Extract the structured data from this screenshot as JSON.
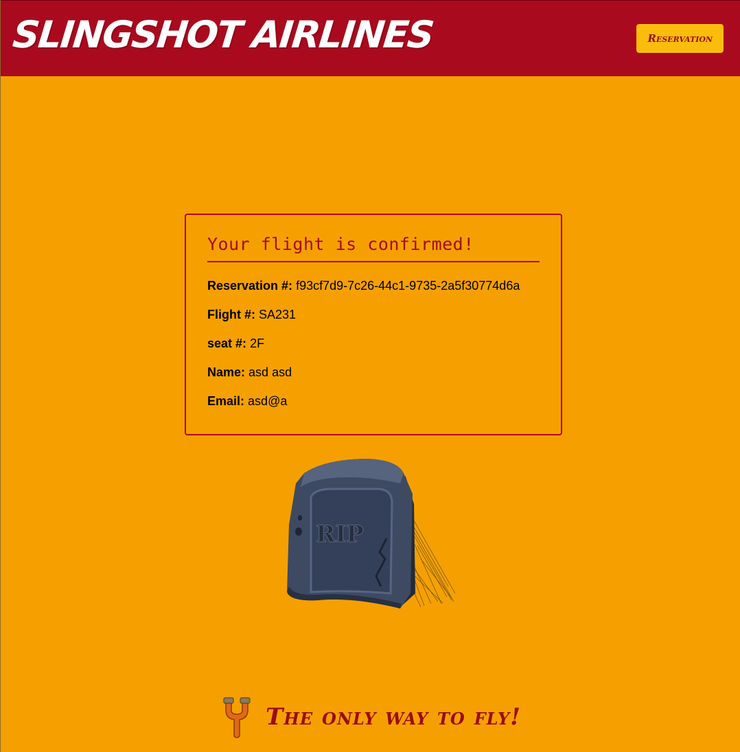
{
  "header": {
    "brand": "Slingshot Airlines",
    "reservation_button": "Reservation",
    "background_color": "#aa0a1e",
    "button_color": "#fbbd0c"
  },
  "confirmation": {
    "title": "Your flight is confirmed!",
    "fields": [
      {
        "label": "Reservation #:",
        "value": "f93cf7d9-7c26-44c1-9735-2a5f30774d6a"
      },
      {
        "label": "Flight #:",
        "value": "SA231"
      },
      {
        "label": "seat #:",
        "value": "2F"
      },
      {
        "label": "Name:",
        "value": "asd asd"
      },
      {
        "label": "Email:",
        "value": "asd@a"
      }
    ],
    "border_color": "#b3081c"
  },
  "illustration": {
    "icon": "tombstone-icon",
    "engraving": "RIP"
  },
  "footer": {
    "icon": "slingshot-icon",
    "tagline": "The only way to fly!"
  },
  "page": {
    "background_color": "#f5a000"
  }
}
